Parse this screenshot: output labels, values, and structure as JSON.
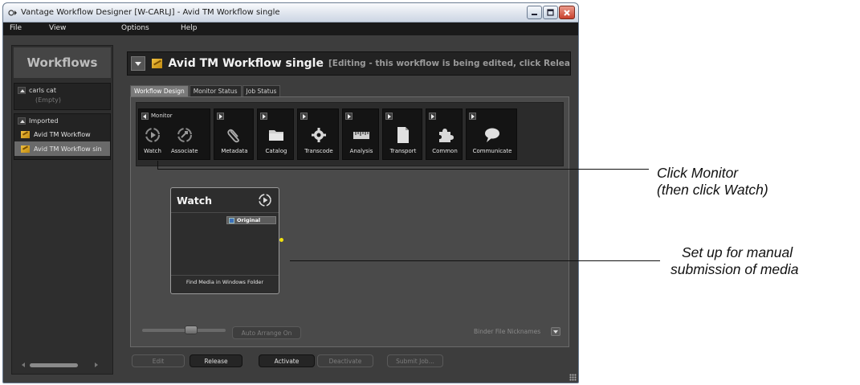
{
  "window": {
    "title": "Vantage Workflow Designer [W-CARLJ]  - Avid TM Workflow single",
    "colors": {
      "close": "#c8402c",
      "accent_port": "#f0e010"
    }
  },
  "menu": [
    "File",
    "View",
    "Options",
    "Help"
  ],
  "sidebar": {
    "title": "Workflows",
    "groups": [
      {
        "name": "carls cat",
        "empty_text": "(Empty)"
      },
      {
        "name": "Imported",
        "items": [
          "Avid TM Workflow",
          "Avid TM Workflow sin"
        ]
      }
    ]
  },
  "workflow": {
    "title": "Avid TM Workflow single",
    "status": "[Editing - this workflow is being edited, click Relea"
  },
  "tabs": [
    "Workflow Design",
    "Monitor Status",
    "Job Status"
  ],
  "toolbar": {
    "monitor_group": "Monitor",
    "tools": [
      "Watch",
      "Associate",
      "Metadata",
      "Catalog",
      "Transcode",
      "Analysis",
      "Transport",
      "Common",
      "Communicate"
    ]
  },
  "node": {
    "title": "Watch",
    "badge": "Original",
    "footer": "Find Media in Windows Folder"
  },
  "bottom": {
    "auto_arrange": "Auto Arrange On",
    "nicknames": "Binder File Nicknames"
  },
  "actions": [
    "Edit",
    "Release",
    "Activate",
    "Deactivate",
    "Submit Job..."
  ],
  "callouts": {
    "monitor": [
      "Click Monitor",
      "(then click Watch)"
    ],
    "manual": [
      "Set up for manual",
      "submission of media"
    ]
  }
}
